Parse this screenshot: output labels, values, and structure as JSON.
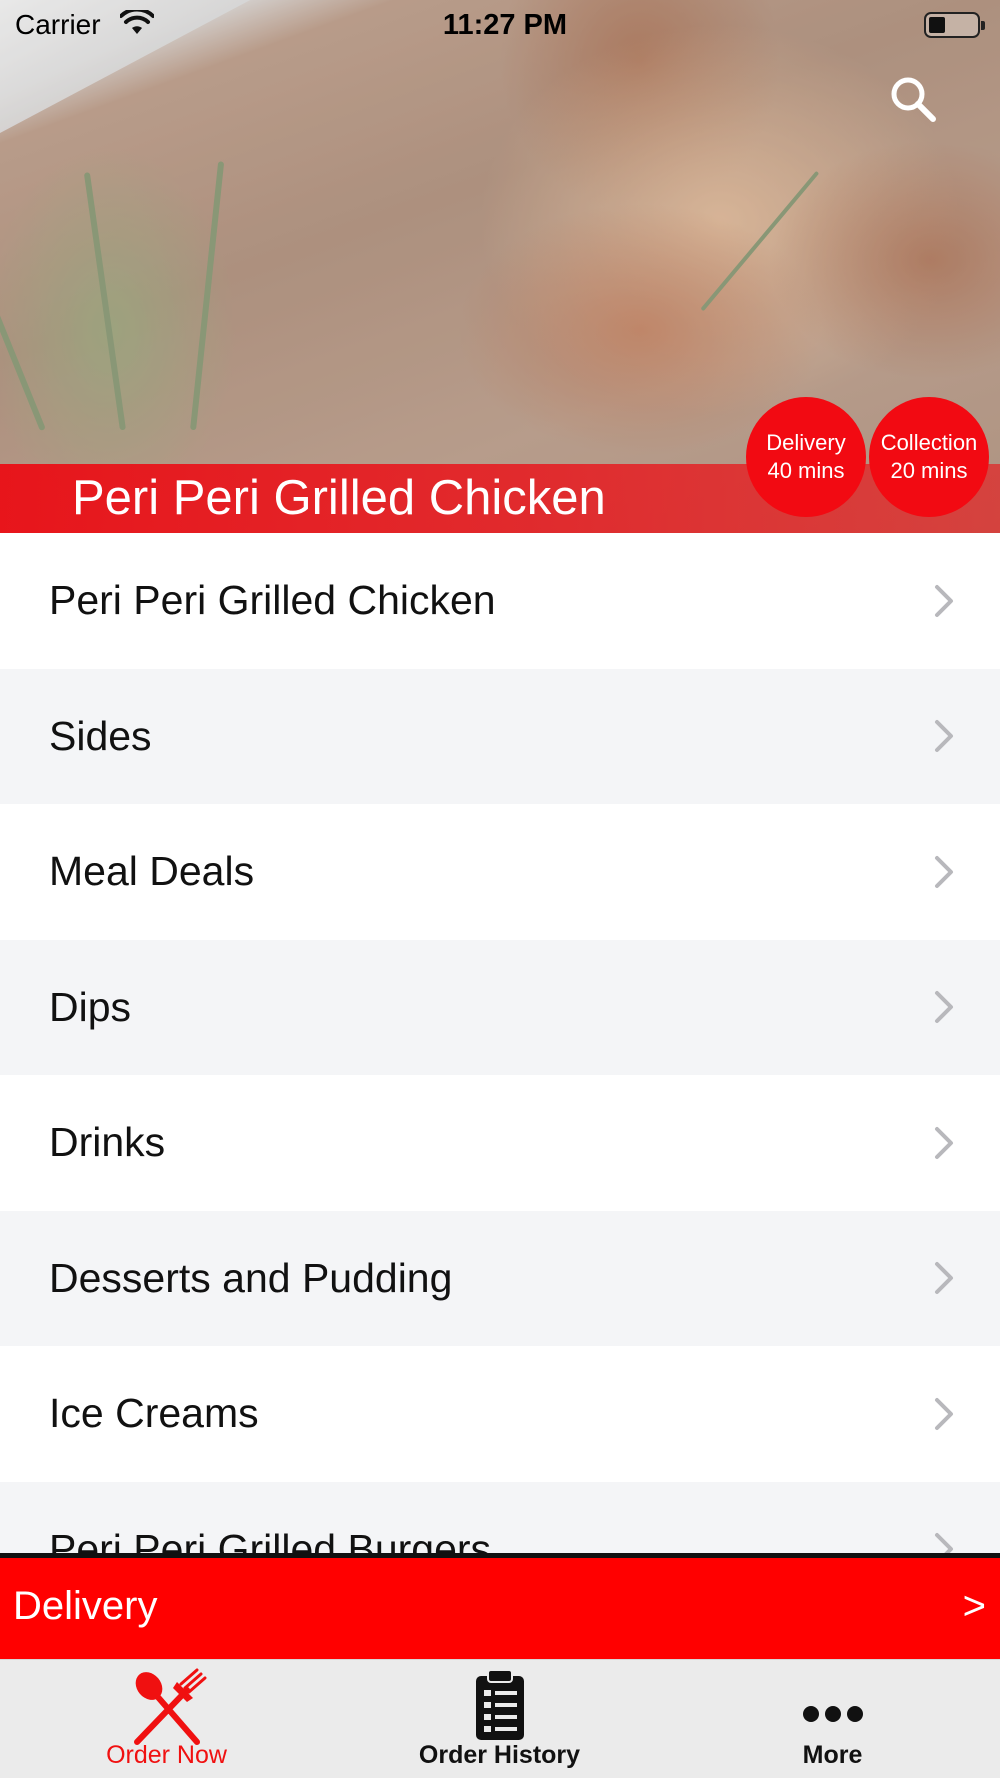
{
  "status_bar": {
    "carrier": "Carrier",
    "time": "11:27 PM"
  },
  "hero": {
    "restaurant_name": "Peri Peri Grilled Chicken",
    "delivery_badge": {
      "label": "Delivery",
      "time": "40 mins"
    },
    "collection_badge": {
      "label": "Collection",
      "time": "20 mins"
    }
  },
  "menu": {
    "categories": [
      {
        "label": "Peri Peri Grilled Chicken"
      },
      {
        "label": "Sides"
      },
      {
        "label": "Meal Deals"
      },
      {
        "label": "Dips"
      },
      {
        "label": "Drinks"
      },
      {
        "label": "Desserts and Pudding"
      },
      {
        "label": "Ice Creams"
      },
      {
        "label": "Peri Peri Grilled Burgers"
      }
    ]
  },
  "order_bar": {
    "mode_label": "Delivery",
    "arrow": ">"
  },
  "tab_bar": {
    "tabs": [
      {
        "label": "Order Now",
        "icon": "fork-knife-icon",
        "active": true
      },
      {
        "label": "Order History",
        "icon": "clipboard-list-icon",
        "active": false
      },
      {
        "label": "More",
        "icon": "more-dots-icon",
        "active": false
      }
    ]
  },
  "colors": {
    "brand_red": "#ff0000",
    "badge_red": "#f20a12",
    "active_tab": "#f01010",
    "row_alt": "#f4f5f7",
    "tab_bar_bg": "#ebebeb"
  }
}
